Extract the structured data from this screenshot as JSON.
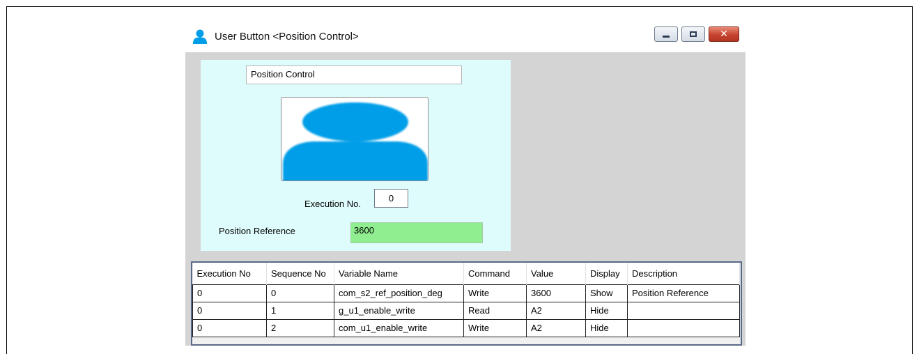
{
  "window": {
    "title": "User Button <Position Control>",
    "user_icon": "user-icon",
    "controls": {
      "minimize": "minimize-icon",
      "maximize": "maximize-icon",
      "close": "close-icon"
    }
  },
  "panel": {
    "name_value": "Position Control",
    "avatar_icon": "user-avatar-icon",
    "execution_label": "Execution No.",
    "execution_value": "0",
    "position_reference_label": "Position Reference",
    "position_reference_value": "3600"
  },
  "table": {
    "columns": [
      "Execution No",
      "Sequence No",
      "Variable Name",
      "Command",
      "Value",
      "Display",
      "Description"
    ],
    "rows": [
      [
        "0",
        "0",
        "com_s2_ref_position_deg",
        "Write",
        "3600",
        "Show",
        "Position Reference"
      ],
      [
        "0",
        "1",
        "g_u1_enable_write",
        "Read",
        "A2",
        "Hide",
        ""
      ],
      [
        "0",
        "2",
        "com_u1_enable_write",
        "Write",
        "A2",
        "Hide",
        ""
      ]
    ]
  },
  "colors": {
    "panel_bg": "#dffcfc",
    "window_bg": "#d4d4d4",
    "accent_blue": "#009ee8",
    "reference_field_bg": "#90ee90"
  }
}
